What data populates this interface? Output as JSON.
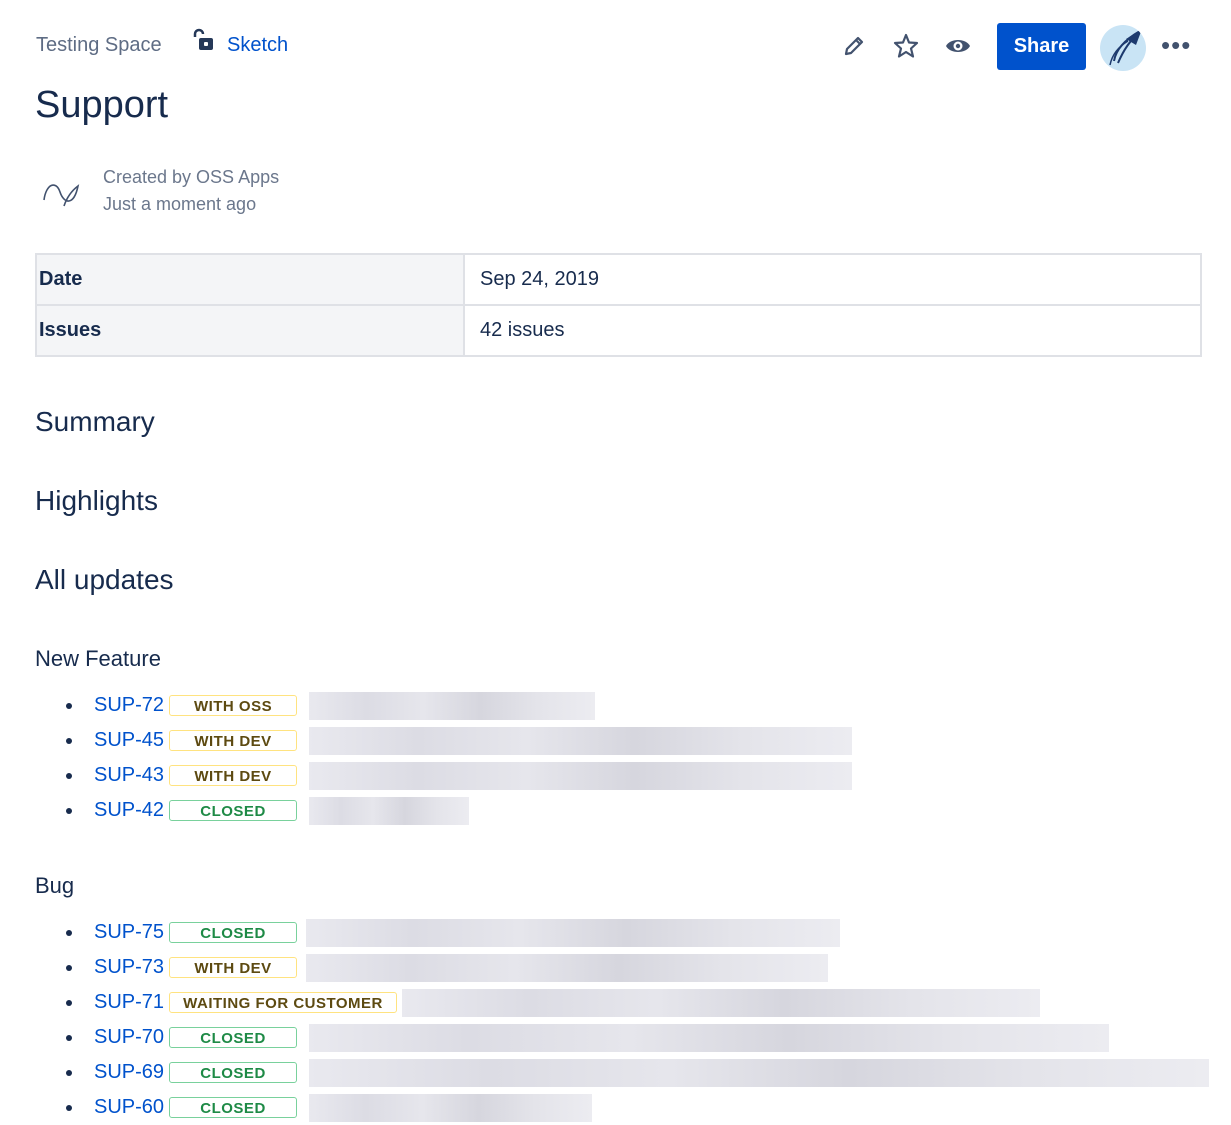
{
  "breadcrumb": {
    "space": "Testing Space",
    "page_link": "Sketch"
  },
  "toolbar": {
    "icons": [
      "edit-icon",
      "star-icon",
      "watch-icon"
    ],
    "share_label": "Share",
    "more_label": "•••"
  },
  "page": {
    "title": "Support"
  },
  "byline": {
    "created_by": "Created by OSS Apps",
    "time": "Just a moment ago"
  },
  "properties": [
    {
      "key": "Date",
      "value": "Sep 24, 2019"
    },
    {
      "key": "Issues",
      "value": "42 issues"
    }
  ],
  "headings": {
    "summary": "Summary",
    "highlights": "Highlights",
    "all_updates": "All updates"
  },
  "groups": [
    {
      "name": "New Feature",
      "issues": [
        {
          "key": "SUP-72",
          "status": "WITH OSS",
          "color": "yellow"
        },
        {
          "key": "SUP-45",
          "status": "WITH DEV",
          "color": "yellow"
        },
        {
          "key": "SUP-43",
          "status": "WITH DEV",
          "color": "yellow"
        },
        {
          "key": "SUP-42",
          "status": "CLOSED",
          "color": "green"
        }
      ]
    },
    {
      "name": "Bug",
      "issues": [
        {
          "key": "SUP-75",
          "status": "CLOSED",
          "color": "green"
        },
        {
          "key": "SUP-73",
          "status": "WITH DEV",
          "color": "yellow"
        },
        {
          "key": "SUP-71",
          "status": "WAITING FOR CUSTOMER",
          "color": "yellow"
        },
        {
          "key": "SUP-70",
          "status": "CLOSED",
          "color": "green"
        },
        {
          "key": "SUP-69",
          "status": "CLOSED",
          "color": "green"
        },
        {
          "key": "SUP-60",
          "status": "CLOSED",
          "color": "green"
        }
      ]
    }
  ],
  "colors": {
    "link": "#0052cc",
    "primary": "#0052cc",
    "text": "#172b4d",
    "muted": "#6b778c"
  }
}
